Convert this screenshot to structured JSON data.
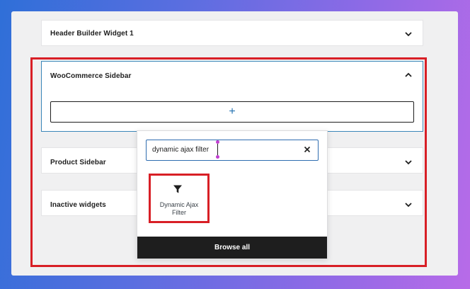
{
  "widget_areas": [
    {
      "title": "Header Builder Widget 1",
      "state": "collapsed"
    },
    {
      "title": "WooCommerce Sidebar",
      "state": "expanded",
      "add_label": "+"
    },
    {
      "title": "Product Sidebar",
      "state": "collapsed"
    },
    {
      "title": "Inactive widgets",
      "state": "collapsed"
    }
  ],
  "inserter": {
    "search_value": "dynamic ajax filter",
    "result": {
      "label": "Dynamic Ajax Filter",
      "icon": "filter-funnel-icon"
    },
    "browse_all_label": "Browse all"
  },
  "colors": {
    "highlight_red": "#d81f26",
    "accent_blue": "#2271b1",
    "focus_border": "#3a86b8",
    "dark_button": "#1e1e1e"
  }
}
